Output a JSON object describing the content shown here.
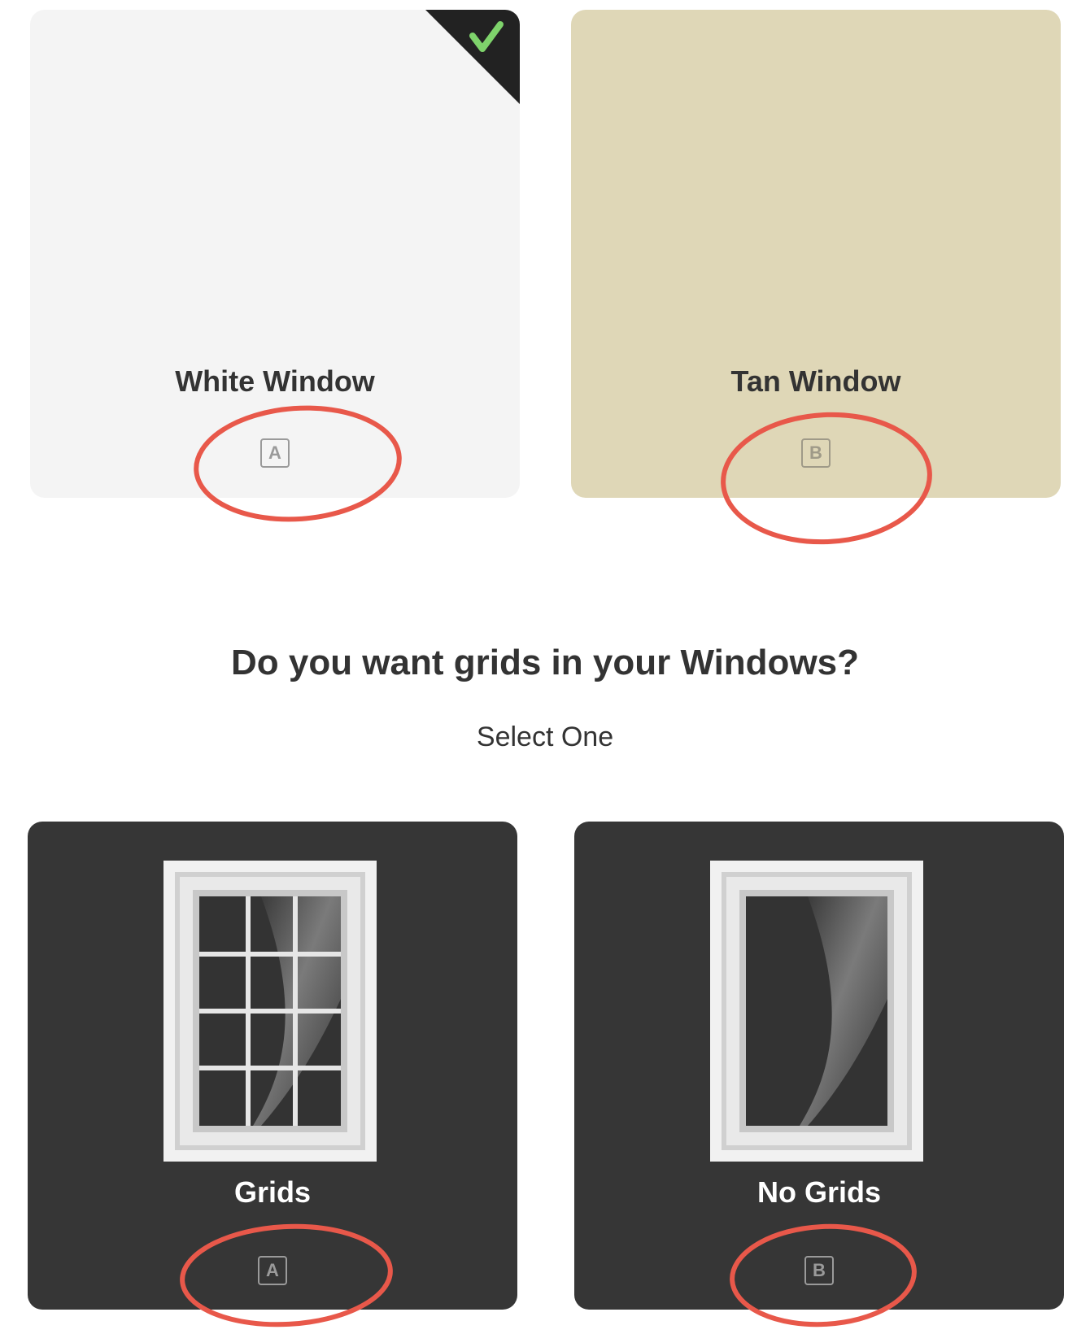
{
  "color_options": [
    {
      "label": "White Window",
      "key": "A",
      "selected": true,
      "color": "#f4f4f4"
    },
    {
      "label": "Tan Window",
      "key": "B",
      "selected": false,
      "color": "#dfd7b7"
    }
  ],
  "grids_question": {
    "title": "Do you want grids in your Windows?",
    "subtitle": "Select One"
  },
  "grid_options": [
    {
      "label": "Grids",
      "key": "A",
      "icon": "window-with-grids-icon"
    },
    {
      "label": "No Grids",
      "key": "B",
      "icon": "window-no-grids-icon"
    }
  ],
  "colors": {
    "card_dark": "#363636",
    "check": "#7ed36b",
    "annotation": "#e8584a"
  }
}
